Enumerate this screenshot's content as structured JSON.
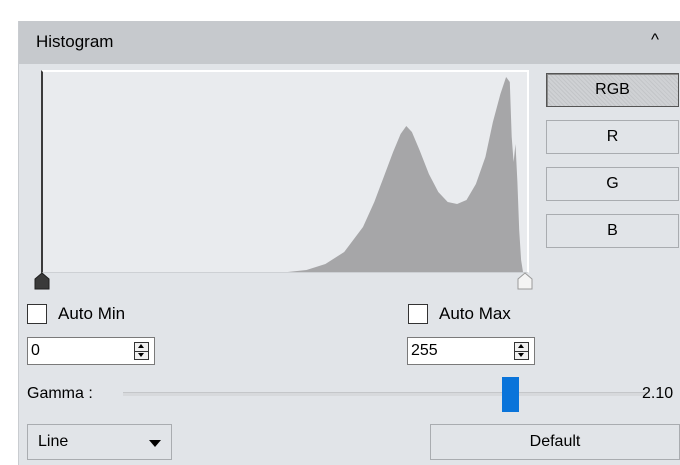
{
  "header": {
    "title": "Histogram",
    "collapse_glyph": "^"
  },
  "histogram": {
    "fill_color": "#a6a6a8",
    "bins": [
      {
        "x": 0,
        "y": 0
      },
      {
        "x": 130,
        "y": 0
      },
      {
        "x": 140,
        "y": 2
      },
      {
        "x": 150,
        "y": 8
      },
      {
        "x": 160,
        "y": 20
      },
      {
        "x": 170,
        "y": 45
      },
      {
        "x": 176,
        "y": 70
      },
      {
        "x": 182,
        "y": 100
      },
      {
        "x": 186,
        "y": 120
      },
      {
        "x": 190,
        "y": 138
      },
      {
        "x": 193,
        "y": 146
      },
      {
        "x": 196,
        "y": 140
      },
      {
        "x": 200,
        "y": 122
      },
      {
        "x": 205,
        "y": 98
      },
      {
        "x": 210,
        "y": 80
      },
      {
        "x": 215,
        "y": 70
      },
      {
        "x": 220,
        "y": 68
      },
      {
        "x": 225,
        "y": 72
      },
      {
        "x": 230,
        "y": 88
      },
      {
        "x": 235,
        "y": 115
      },
      {
        "x": 239,
        "y": 150
      },
      {
        "x": 243,
        "y": 178
      },
      {
        "x": 246,
        "y": 195
      },
      {
        "x": 248,
        "y": 190
      },
      {
        "x": 249,
        "y": 135
      },
      {
        "x": 250,
        "y": 110
      },
      {
        "x": 251,
        "y": 128
      },
      {
        "x": 252,
        "y": 90
      },
      {
        "x": 253,
        "y": 42
      },
      {
        "x": 254,
        "y": 12
      },
      {
        "x": 255,
        "y": 0
      }
    ],
    "x_range": [
      0,
      255
    ],
    "y_range": [
      0,
      200
    ],
    "min_marker": 0,
    "max_marker": 255
  },
  "channels": [
    {
      "label": "RGB",
      "active": true
    },
    {
      "label": "R",
      "active": false
    },
    {
      "label": "G",
      "active": false
    },
    {
      "label": "B",
      "active": false
    }
  ],
  "auto_min": {
    "label": "Auto Min",
    "checked": false,
    "value": "0"
  },
  "auto_max": {
    "label": "Auto Max",
    "checked": false,
    "value": "255"
  },
  "gamma": {
    "label": "Gamma :",
    "value": "2.10",
    "slider_fraction": 0.75,
    "accent": "#0a74da"
  },
  "draw_mode": {
    "selected": "Line"
  },
  "default_button": {
    "label": "Default"
  }
}
